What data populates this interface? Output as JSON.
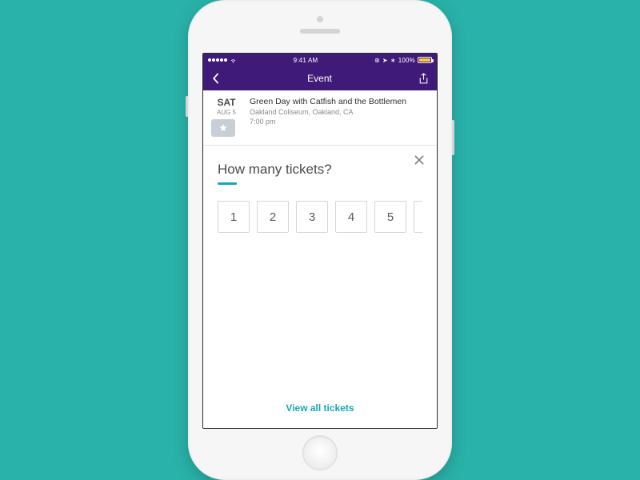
{
  "statusbar": {
    "time": "9:41 AM",
    "battery_pct": "100%"
  },
  "navbar": {
    "title": "Event"
  },
  "event": {
    "day_of_week": "SAT",
    "month_day": "AUG 5",
    "title": "Green Day with Catfish and the Bottlemen",
    "venue": "Oakland Coliseum, Oakland, CA",
    "time": "7:00 pm"
  },
  "sheet": {
    "question": "How many tickets?",
    "options": [
      "1",
      "2",
      "3",
      "4",
      "5"
    ],
    "view_all_label": "View all tickets"
  }
}
